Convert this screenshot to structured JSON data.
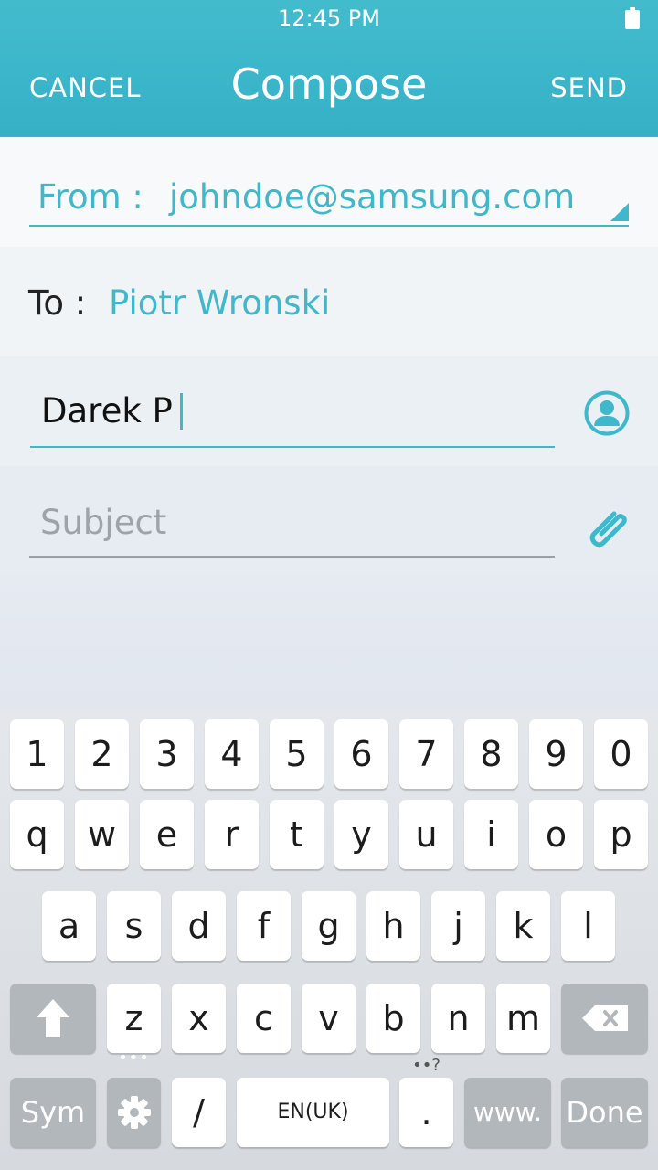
{
  "status_bar": {
    "time": "12:45 PM",
    "battery_icon": "battery-full-icon"
  },
  "header": {
    "cancel_label": "CANCEL",
    "title": "Compose",
    "send_label": "SEND"
  },
  "from": {
    "label": "From :",
    "value": "johndoe@samsung.com"
  },
  "to": {
    "label": "To :",
    "recipient": "Piotr Wronski"
  },
  "cc_input": {
    "value": "Darek P"
  },
  "subject": {
    "placeholder": "Subject"
  },
  "colors": {
    "accent": "#3fb8cb",
    "header_bg": "#3cb6cb",
    "key_dark": "#b2b7bc"
  },
  "keyboard": {
    "row_numbers": [
      "1",
      "2",
      "3",
      "4",
      "5",
      "6",
      "7",
      "8",
      "9",
      "0"
    ],
    "row_top": [
      "q",
      "w",
      "e",
      "r",
      "t",
      "y",
      "u",
      "i",
      "o",
      "p"
    ],
    "row_middle": [
      "a",
      "s",
      "d",
      "f",
      "g",
      "h",
      "j",
      "k",
      "l"
    ],
    "row_bottom": [
      "z",
      "x",
      "c",
      "v",
      "b",
      "n",
      "m"
    ],
    "sym_label": "Sym",
    "slash_label": "/",
    "space_label": "EN(UK)",
    "period_label": ".",
    "period_hint": "••?",
    "settings_hint": "•••",
    "www_label": "www.",
    "done_label": "Done"
  }
}
